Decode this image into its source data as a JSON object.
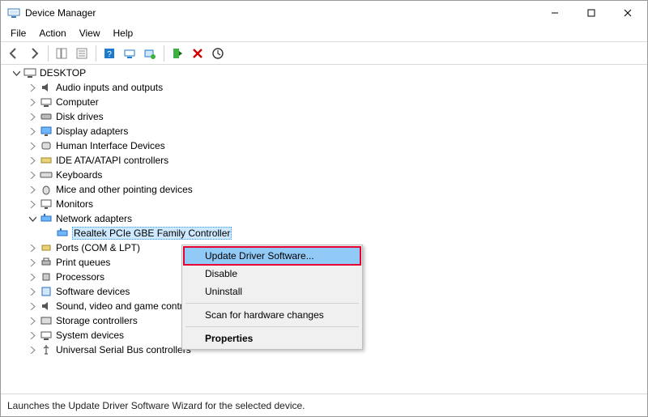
{
  "window": {
    "title": "Device Manager"
  },
  "menubar": {
    "file": "File",
    "action": "Action",
    "view": "View",
    "help": "Help"
  },
  "tree": {
    "root": "DESKTOP",
    "items": [
      "Audio inputs and outputs",
      "Computer",
      "Disk drives",
      "Display adapters",
      "Human Interface Devices",
      "IDE ATA/ATAPI controllers",
      "Keyboards",
      "Mice and other pointing devices",
      "Monitors",
      "Network adapters",
      "Ports (COM & LPT)",
      "Print queues",
      "Processors",
      "Software devices",
      "Sound, video and game controllers",
      "Storage controllers",
      "System devices",
      "Universal Serial Bus controllers"
    ],
    "selected_subitem": "Realtek PCIe GBE Family Controller"
  },
  "context_menu": {
    "update": "Update Driver Software...",
    "disable": "Disable",
    "uninstall": "Uninstall",
    "scan": "Scan for hardware changes",
    "properties": "Properties"
  },
  "status": "Launches the Update Driver Software Wizard for the selected device."
}
